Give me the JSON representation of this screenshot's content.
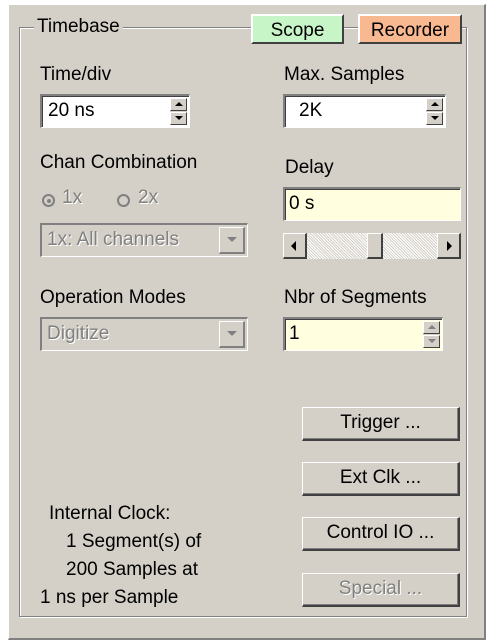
{
  "group_title": "Timebase",
  "tabs": {
    "scope": {
      "label": "Scope",
      "color": "#c8f5c8"
    },
    "recorder": {
      "label": "Recorder",
      "color": "#f8b890"
    }
  },
  "time_div": {
    "label": "Time/div",
    "value": "20 ns"
  },
  "max_samples": {
    "label": "Max. Samples",
    "value": "2K"
  },
  "chan_combination": {
    "label": "Chan Combination",
    "radio_1x": {
      "label": "1x",
      "selected": true
    },
    "radio_2x": {
      "label": "2x",
      "selected": false
    },
    "select_value": "1x: All channels"
  },
  "delay": {
    "label": "Delay",
    "value": "0 s"
  },
  "operation_modes": {
    "label": "Operation Modes",
    "value": "Digitize"
  },
  "segments": {
    "label": "Nbr of Segments",
    "value": "1"
  },
  "buttons": {
    "trigger": "Trigger ...",
    "ext_clk": "Ext Clk ...",
    "control_io": "Control IO ...",
    "special": "Special ..."
  },
  "clock_info": {
    "line1": "Internal Clock:",
    "line2": "1 Segment(s) of",
    "line3": "200 Samples at",
    "line4": "1 ns per Sample"
  }
}
